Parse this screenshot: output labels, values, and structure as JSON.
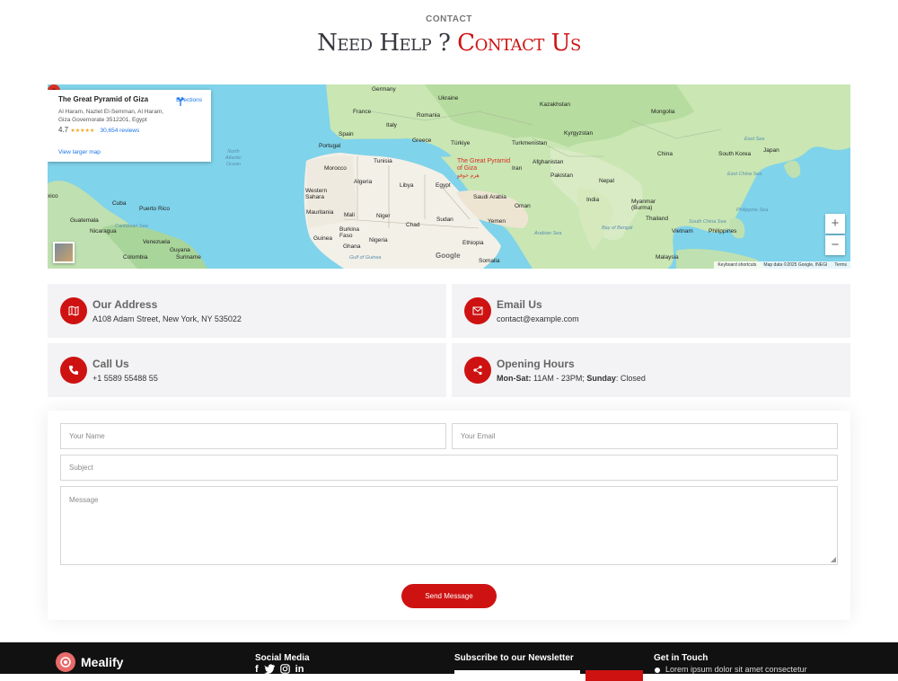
{
  "header": {
    "kicker": "CONTACT",
    "title_plain": "Need Help ?",
    "title_accent": "Contact Us"
  },
  "map": {
    "card": {
      "place": "The Great Pyramid of Giza",
      "address": "Al Haram, Nazlet El-Semman, Al Haram, Giza Governorate 3512201, Egypt",
      "rating": "4.7",
      "stars": "★★★★★",
      "reviews": "30,654 reviews",
      "directions": "Directions",
      "view_larger": "View larger map"
    },
    "pin_label": "The Great Pyramid of Giza",
    "pin_label_ar": "هرم خوفو",
    "labels": {
      "germany": "Germany",
      "ukraine": "Ukraine",
      "kazakhstan": "Kazakhstan",
      "mongolia": "Mongolia",
      "france": "France",
      "romania": "Romania",
      "italy": "Italy",
      "spain": "Spain",
      "portugal": "Portugal",
      "greece": "Greece",
      "turkiye": "Türkiye",
      "turkmenistan": "Turkmenistan",
      "kyrgyzstan": "Kyrgyzstan",
      "china": "China",
      "south_korea": "South Korea",
      "japan": "Japan",
      "tunisia": "Tunisia",
      "morocco": "Morocco",
      "algeria": "Algeria",
      "libya": "Libya",
      "egypt": "Egypt",
      "iran": "Iran",
      "afghanistan": "Afghanistan",
      "pakistan": "Pakistan",
      "nepal": "Nepal",
      "saudi_arabia": "Saudi Arabia",
      "oman": "Oman",
      "india": "India",
      "western_sahara": "Western Sahara",
      "mali": "Mali",
      "niger": "Niger",
      "chad": "Chad",
      "sudan": "Sudan",
      "yemen": "Yemen",
      "mauritania": "Mauritania",
      "burkina_faso": "Burkina Faso",
      "nigeria": "Nigeria",
      "guinea": "Guinea",
      "ghana": "Ghana",
      "ethiopia": "Ethiopia",
      "somalia": "Somalia",
      "myanmar": "Myanmar (Burma)",
      "thailand": "Thailand",
      "vietnam": "Vietnam",
      "philippines": "Philippines",
      "malaysia": "Malaysia",
      "cuba": "Cuba",
      "guatemala": "Guatemala",
      "nicaragua": "Nicaragua",
      "puerto_rico": "Puerto Rico",
      "venezuela": "Venezuela",
      "colombia": "Colombia",
      "guyana": "Guyana",
      "suriname": "Suriname",
      "mexico": "xico",
      "north_atlantic": "North Atlantic Ocean",
      "arabian_sea": "Arabian Sea",
      "bay_of_bengal": "Bay of Bengal",
      "east_china_sea": "East China Sea",
      "philippine_sea": "Philippine Sea",
      "south_china_sea": "South China Sea",
      "gulf_of_guinea": "Gulf of Guinea",
      "caribbean_sea": "Caribbean Sea",
      "east_sea": "East Sea"
    },
    "zoom_in": "+",
    "zoom_out": "−",
    "google": "Google",
    "attribution": {
      "shortcuts": "Keyboard shortcuts",
      "data": "Map data ©2025 Google, INEGI",
      "terms": "Terms"
    }
  },
  "info": {
    "address": {
      "title": "Our Address",
      "value": "A108 Adam Street, New York, NY 535022"
    },
    "email": {
      "title": "Email Us",
      "value": "contact@example.com"
    },
    "call": {
      "title": "Call Us",
      "value": "+1 5589 55488 55"
    },
    "hours": {
      "title": "Opening Hours",
      "days1": "Mon-Sat:",
      "time1": " 11AM - 23PM; ",
      "days2": "Sunday",
      "time2": ": Closed"
    }
  },
  "form": {
    "name_placeholder": "Your Name",
    "email_placeholder": "Your Email",
    "subject_placeholder": "Subject",
    "message_placeholder": "Message",
    "submit": "Send Message"
  },
  "footer": {
    "brand": "Mealify",
    "social_title": "Social Media",
    "newsletter_title": "Subscribe to our Newsletter",
    "touch_title": "Get in Touch",
    "touch_text": "Lorem ipsum dolor sit amet consectetur"
  },
  "colors": {
    "accent": "#ce1212",
    "footer_bg": "#111111",
    "info_bg": "#f3f3f5"
  }
}
